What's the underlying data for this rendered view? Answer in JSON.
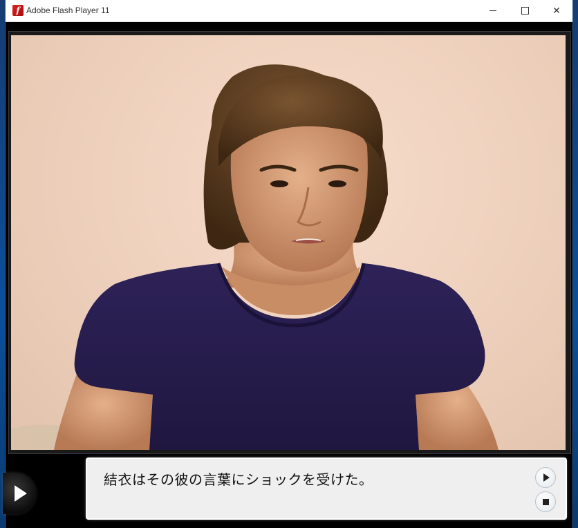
{
  "window": {
    "title": "Adobe Flash Player 11",
    "app_icon": "flash-icon",
    "controls": [
      "minimize-icon",
      "maximize-icon",
      "close-icon"
    ],
    "close_glyph": "✕"
  },
  "scene": {
    "background_color": "#efd2be",
    "character": "man-with-shoulder-length-brown-hair-in-navy-tshirt"
  },
  "message": {
    "text": "結衣はその彼の言葉にショックを受けた。"
  },
  "controls": {
    "skip_icon": "play-arrow-icon",
    "play_icon": "play-icon",
    "stop_icon": "stop-icon"
  },
  "colors": {
    "shirt": "#2a1f52",
    "hair": "#5a3a1e",
    "skin": "#d9a07a",
    "message_bg": "#efefef"
  }
}
